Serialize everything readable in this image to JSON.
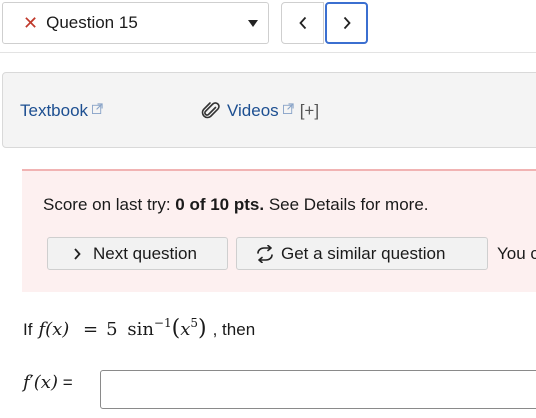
{
  "question_selector": {
    "current": "Question 15",
    "status_icon": "x-icon",
    "status_color": "#c0392b"
  },
  "nav": {
    "prev_icon": "chevron-left-icon",
    "next_icon": "chevron-right-icon"
  },
  "resources": {
    "textbook_label": "Textbook",
    "videos_label": "Videos",
    "expand_label": "[+]",
    "link_color": "#1d4f91"
  },
  "score": {
    "prefix": "Score on last try: ",
    "value": "0 of 10 pts.",
    "suffix": " See Details for more.",
    "next_question_label": "Next question",
    "similar_question_label": "Get a similar question",
    "trailing_text": "You c"
  },
  "question": {
    "intro": "If",
    "fx": "f(x)",
    "equals": "=",
    "coefficient": "5",
    "function": "sin",
    "exponent": "−1",
    "argument": "x",
    "arg_exponent": "5",
    "then_text": ", then"
  },
  "answer": {
    "label_fn": "f",
    "label_prime": "′",
    "label_arg": "(x)",
    "label_equals": " =",
    "value": "",
    "placeholder": ""
  }
}
